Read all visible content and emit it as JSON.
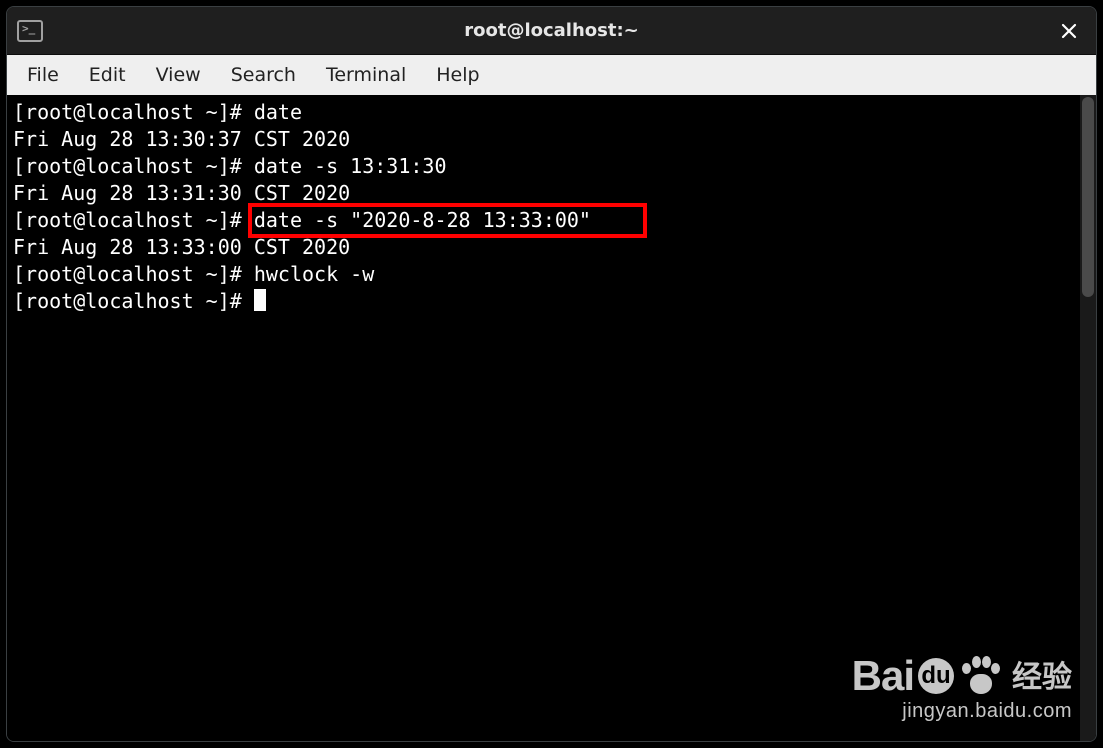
{
  "window": {
    "title": "root@localhost:~"
  },
  "menubar": {
    "file": "File",
    "edit": "Edit",
    "view": "View",
    "search": "Search",
    "terminal": "Terminal",
    "help": "Help"
  },
  "prompt": "[root@localhost ~]# ",
  "lines": [
    {
      "prompt": true,
      "cmd": "date"
    },
    {
      "prompt": false,
      "text": "Fri Aug 28 13:30:37 CST 2020"
    },
    {
      "prompt": true,
      "cmd": "date -s 13:31:30"
    },
    {
      "prompt": false,
      "text": "Fri Aug 28 13:31:30 CST 2020"
    },
    {
      "prompt": true,
      "cmd": "date -s \"2020-8-28 13:33:00\"",
      "highlight": true
    },
    {
      "prompt": false,
      "text": "Fri Aug 28 13:33:00 CST 2020"
    },
    {
      "prompt": true,
      "cmd": "hwclock -w"
    },
    {
      "prompt": true,
      "cmd": "",
      "cursor": true
    }
  ],
  "watermark": {
    "brand_left": "Bai",
    "brand_circle": "du",
    "brand_right": "经验",
    "url": "jingyan.baidu.com"
  }
}
